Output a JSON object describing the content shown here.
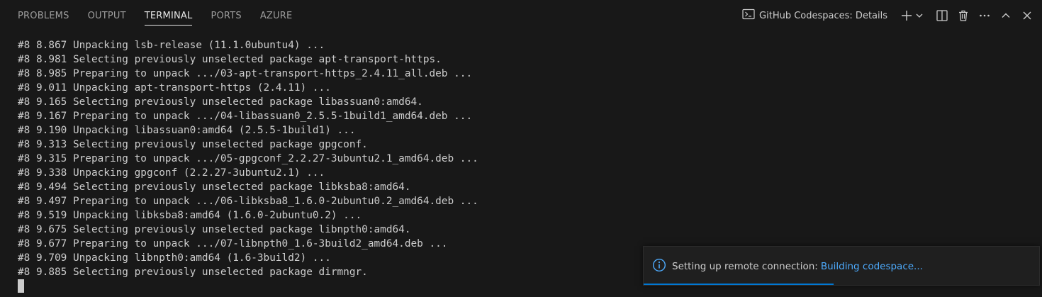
{
  "panel": {
    "tabs": [
      {
        "label": "PROBLEMS",
        "active": false
      },
      {
        "label": "OUTPUT",
        "active": false
      },
      {
        "label": "TERMINAL",
        "active": true
      },
      {
        "label": "PORTS",
        "active": false
      },
      {
        "label": "AZURE",
        "active": false
      }
    ],
    "session_label": "GitHub Codespaces: Details",
    "icons": {
      "session": "terminal-icon",
      "new": "plus-icon",
      "dropdown": "chevron-down-icon",
      "split": "split-terminal-icon",
      "kill": "trash-icon",
      "more": "ellipsis-icon",
      "maximize": "chevron-up-icon",
      "close": "close-icon"
    }
  },
  "terminal": {
    "lines": [
      "#8 8.867 Unpacking lsb-release (11.1.0ubuntu4) ...",
      "#8 8.981 Selecting previously unselected package apt-transport-https.",
      "#8 8.985 Preparing to unpack .../03-apt-transport-https_2.4.11_all.deb ...",
      "#8 9.011 Unpacking apt-transport-https (2.4.11) ...",
      "#8 9.165 Selecting previously unselected package libassuan0:amd64.",
      "#8 9.167 Preparing to unpack .../04-libassuan0_2.5.5-1build1_amd64.deb ...",
      "#8 9.190 Unpacking libassuan0:amd64 (2.5.5-1build1) ...",
      "#8 9.313 Selecting previously unselected package gpgconf.",
      "#8 9.315 Preparing to unpack .../05-gpgconf_2.2.27-3ubuntu2.1_amd64.deb ...",
      "#8 9.338 Unpacking gpgconf (2.2.27-3ubuntu2.1) ...",
      "#8 9.494 Selecting previously unselected package libksba8:amd64.",
      "#8 9.497 Preparing to unpack .../06-libksba8_1.6.0-2ubuntu0.2_amd64.deb ...",
      "#8 9.519 Unpacking libksba8:amd64 (1.6.0-2ubuntu0.2) ...",
      "#8 9.675 Selecting previously unselected package libnpth0:amd64.",
      "#8 9.677 Preparing to unpack .../07-libnpth0_1.6-3build2_amd64.deb ...",
      "#8 9.709 Unpacking libnpth0:amd64 (1.6-3build2) ...",
      "#8 9.885 Selecting previously unselected package dirmngr."
    ]
  },
  "notification": {
    "icon": "info-icon",
    "message": "Setting up remote connection:",
    "link": "Building codespace...",
    "progress": 0.48
  },
  "colors": {
    "background": "#181818",
    "text": "#cccccc",
    "link": "#4daafc",
    "info_icon": "#4daafc",
    "progress": "#0078d4"
  }
}
